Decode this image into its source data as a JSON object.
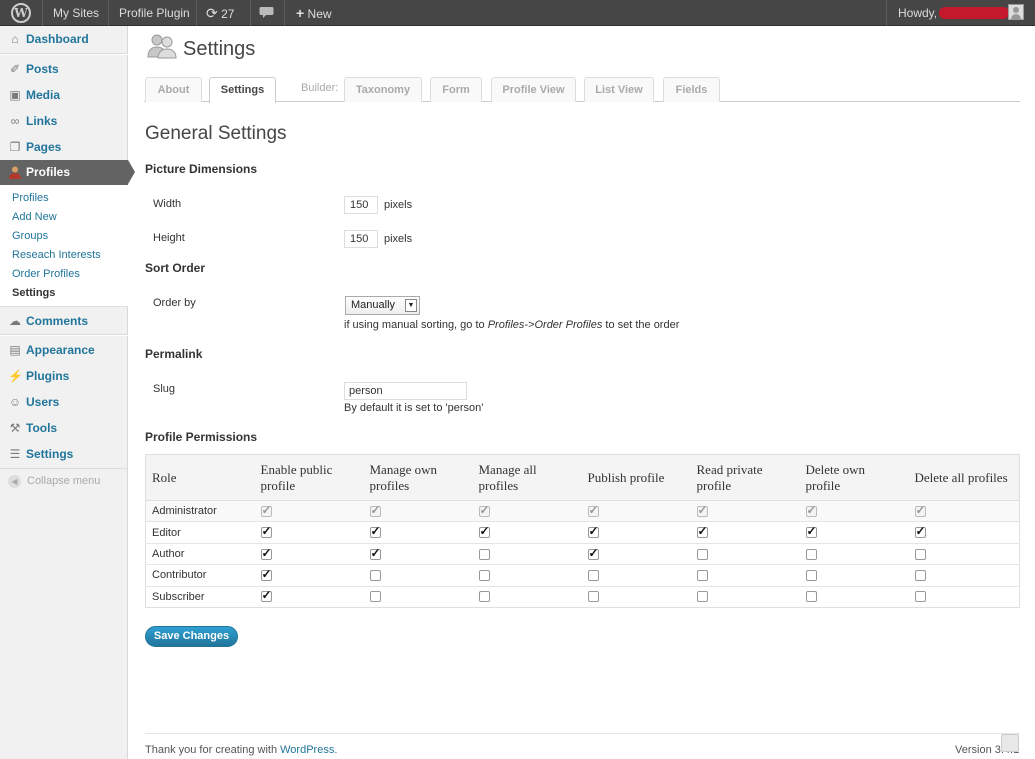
{
  "admin_bar": {
    "my_sites": "My Sites",
    "site_name": "Profile Plugin",
    "updates_count": "27",
    "new_label": "New",
    "howdy": "Howdy,"
  },
  "sidebar": {
    "items": [
      {
        "label": "Dashboard",
        "icon": "house-icon"
      },
      {
        "label": "Posts",
        "icon": "pushpin-icon"
      },
      {
        "label": "Media",
        "icon": "media-icon"
      },
      {
        "label": "Links",
        "icon": "link-icon"
      },
      {
        "label": "Pages",
        "icon": "pages-icon"
      },
      {
        "label": "Profiles",
        "icon": "person-icon"
      },
      {
        "label": "Comments",
        "icon": "speech-bubble-icon"
      },
      {
        "label": "Appearance",
        "icon": "appearance-icon"
      },
      {
        "label": "Plugins",
        "icon": "plug-icon"
      },
      {
        "label": "Users",
        "icon": "users-icon"
      },
      {
        "label": "Tools",
        "icon": "tools-icon"
      },
      {
        "label": "Settings",
        "icon": "settings-icon"
      }
    ],
    "submenu": [
      "Profiles",
      "Add New",
      "Groups",
      "Reseach Interests",
      "Order Profiles",
      "Settings"
    ],
    "collapse": "Collapse menu"
  },
  "page": {
    "title": "Settings",
    "tabs": [
      "About",
      "Settings"
    ],
    "builder_label": "Builder:",
    "builder_tabs": [
      "Taxonomy",
      "Form",
      "Profile View",
      "List View",
      "Fields"
    ],
    "general_heading": "General Settings",
    "picture": {
      "heading": "Picture Dimensions",
      "width_label": "Width",
      "width_value": "150",
      "height_label": "Height",
      "height_value": "150",
      "unit": "pixels"
    },
    "sort": {
      "heading": "Sort Order",
      "order_by_label": "Order by",
      "selected": "Manually",
      "help_prefix": "if using manual sorting, go to ",
      "help_path": "Profiles->Order Profiles",
      "help_suffix": " to set the order"
    },
    "permalink": {
      "heading": "Permalink",
      "slug_label": "Slug",
      "slug_value": "person",
      "help": "By default it is set to 'person'"
    },
    "permissions": {
      "heading": "Profile Permissions",
      "columns": [
        "Role",
        "Enable public profile",
        "Manage own profiles",
        "Manage all profiles",
        "Publish profile",
        "Read private profile",
        "Delete own profile",
        "Delete all profiles"
      ],
      "rows": [
        {
          "role": "Administrator",
          "checks": [
            true,
            true,
            true,
            true,
            true,
            true,
            true
          ],
          "disabled": true
        },
        {
          "role": "Editor",
          "checks": [
            true,
            true,
            true,
            true,
            true,
            true,
            true
          ],
          "disabled": false
        },
        {
          "role": "Author",
          "checks": [
            true,
            true,
            false,
            true,
            false,
            false,
            false
          ],
          "disabled": false
        },
        {
          "role": "Contributor",
          "checks": [
            true,
            false,
            false,
            false,
            false,
            false,
            false
          ],
          "disabled": false
        },
        {
          "role": "Subscriber",
          "checks": [
            true,
            false,
            false,
            false,
            false,
            false,
            false
          ],
          "disabled": false
        }
      ]
    },
    "save_button": "Save Changes"
  },
  "footer": {
    "thanks": "Thank you for creating with ",
    "wordpress_link": "WordPress",
    "thanks_end": ".",
    "version": "Version 3.4.1"
  },
  "colors": {
    "admin_bar": "#464646",
    "link": "#21759b",
    "active_menu": "#636363",
    "button": "#21759b"
  }
}
